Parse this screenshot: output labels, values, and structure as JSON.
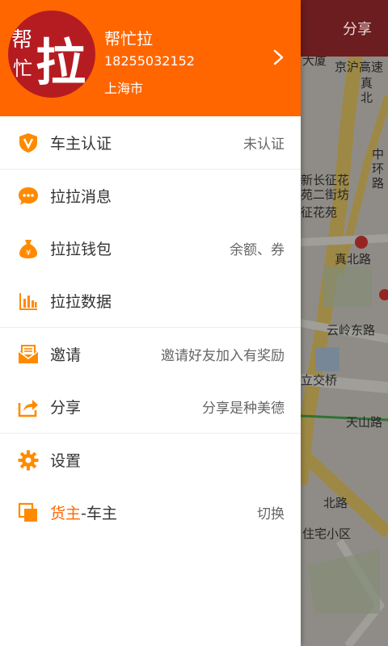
{
  "map": {
    "top_share_label": "分享",
    "labels": [
      {
        "text": "大厦",
        "blue": false
      },
      {
        "text": "京沪高速",
        "blue": false
      },
      {
        "text": "真",
        "blue": false
      },
      {
        "text": "北",
        "blue": false
      },
      {
        "text": "中",
        "blue": false
      },
      {
        "text": "环",
        "blue": false
      },
      {
        "text": "路",
        "blue": false
      },
      {
        "text": "新长征花",
        "blue": false
      },
      {
        "text": "苑二街坊",
        "blue": false
      },
      {
        "text": "征花苑",
        "blue": false
      },
      {
        "text": "真北路",
        "blue": false
      },
      {
        "text": "云岭东路",
        "blue": false
      },
      {
        "text": "立交桥",
        "blue": false
      },
      {
        "text": "天山路",
        "blue": false
      },
      {
        "text": "北路",
        "blue": false
      },
      {
        "text": "住宅小区",
        "blue": false
      }
    ]
  },
  "profile": {
    "avatar_big": "拉",
    "avatar_small1": "帮",
    "avatar_small2": "忙",
    "name": "帮忙拉",
    "phone": "18255032152",
    "city": "上海市"
  },
  "menu": {
    "items": [
      {
        "label": "车主认证",
        "value": "未认证",
        "icon": "verify-shield-icon"
      },
      {
        "label": "拉拉消息",
        "value": "",
        "icon": "message-bubble-icon"
      },
      {
        "label": "拉拉钱包",
        "value": "余额、券",
        "icon": "money-bag-icon"
      },
      {
        "label": "拉拉数据",
        "value": "",
        "icon": "bar-chart-icon"
      },
      {
        "label": "邀请",
        "value": "邀请好友加入有奖励",
        "icon": "invite-envelope-icon"
      },
      {
        "label": "分享",
        "value": "分享是种美德",
        "icon": "share-icon"
      },
      {
        "label": "设置",
        "value": "",
        "icon": "gear-icon"
      }
    ],
    "switch": {
      "label_highlight": "货主",
      "label_rest": "-车主",
      "value": "切换"
    }
  },
  "colors": {
    "accent": "#ff6600",
    "avatar_bg": "#b51c22",
    "topbar": "#6b1d1f"
  }
}
